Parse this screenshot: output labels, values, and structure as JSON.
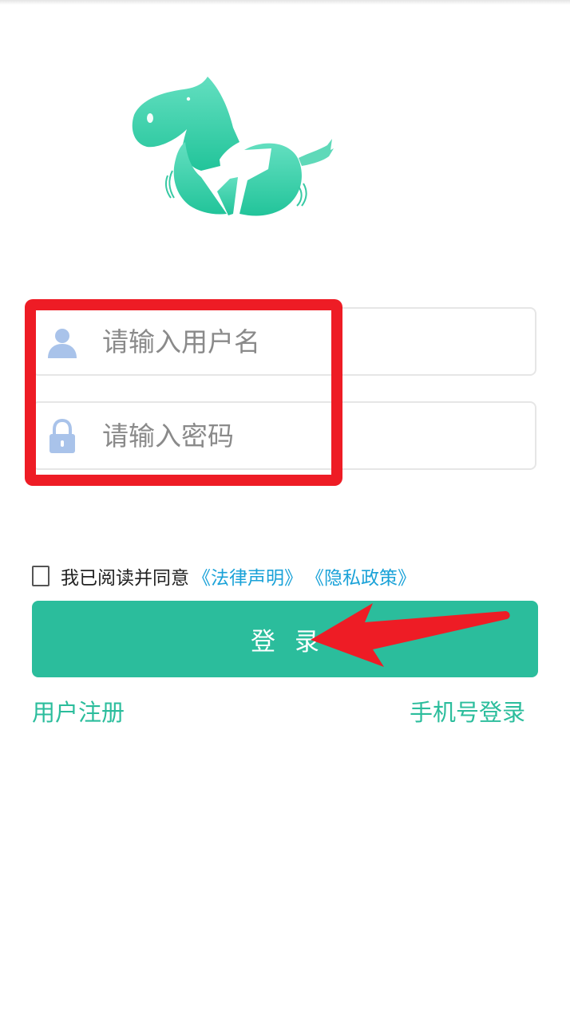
{
  "logo": {
    "icon": "horse-logo-icon"
  },
  "form": {
    "username": {
      "icon": "user-icon",
      "placeholder": "请输入用户名",
      "value": ""
    },
    "password": {
      "icon": "lock-icon",
      "placeholder": "请输入密码",
      "value": ""
    }
  },
  "agreement": {
    "checked": false,
    "text": "我已阅读并同意",
    "legal_link": "《法律声明》",
    "privacy_link": "《隐私政策》"
  },
  "login_button": {
    "label": "登录"
  },
  "links": {
    "register": "用户注册",
    "phone_login": "手机号登录"
  },
  "annotations": {
    "highlight_color": "#ee1c25",
    "arrow_color": "#ee1c25"
  },
  "colors": {
    "accent": "#2bbd9c",
    "link": "#1aa2d8",
    "field_icon": "#a9c3ea"
  }
}
